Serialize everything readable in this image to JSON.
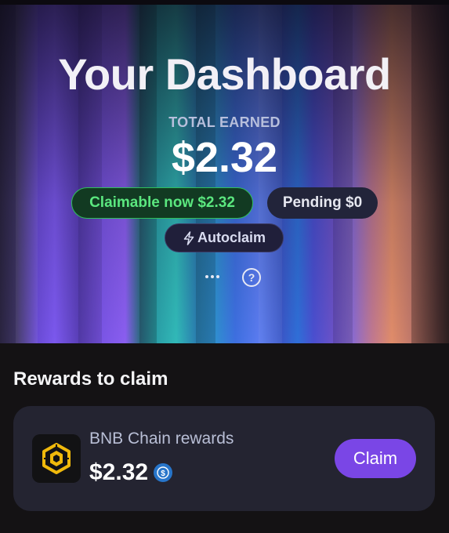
{
  "header": {
    "title": "Your Dashboard",
    "total_earned_label": "TOTAL EARNED",
    "total_earned_value": "$2.32"
  },
  "badges": {
    "claimable": "Claimable now $2.32",
    "pending": "Pending $0",
    "autoclaim": "Autoclaim"
  },
  "actions": {
    "more_icon": "more-dots-icon",
    "help_icon": "help-circle-icon",
    "help_glyph": "?"
  },
  "rewards": {
    "section_title": "Rewards to claim",
    "items": [
      {
        "name": "BNB Chain rewards",
        "amount": "$2.32",
        "token_icon": "bnb-chain-icon",
        "currency_icon": "usdc-icon",
        "claim_label": "Claim"
      }
    ]
  },
  "colors": {
    "claimable_text": "#5be77f",
    "claim_button": "#7a46e6",
    "card_bg": "#242431",
    "page_bg": "#141214"
  }
}
